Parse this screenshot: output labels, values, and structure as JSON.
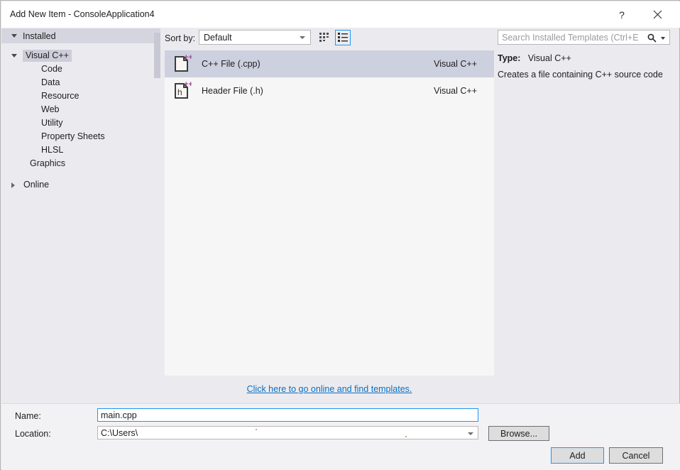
{
  "window": {
    "title": "Add New Item - ConsoleApplication4",
    "help_label": "?",
    "close_label": "✕",
    "help_icon": "question-mark-icon",
    "close_icon": "close-icon"
  },
  "sidebar": {
    "installed": {
      "label": "Installed",
      "expanded": true
    },
    "tree": [
      {
        "label": "Visual C++",
        "level": 1,
        "selected": true,
        "expanded": true
      },
      {
        "label": "Code",
        "level": 2,
        "selected": false
      },
      {
        "label": "Data",
        "level": 2,
        "selected": false
      },
      {
        "label": "Resource",
        "level": 2,
        "selected": false
      },
      {
        "label": "Web",
        "level": 2,
        "selected": false
      },
      {
        "label": "Utility",
        "level": 2,
        "selected": false
      },
      {
        "label": "Property Sheets",
        "level": 2,
        "selected": false
      },
      {
        "label": "HLSL",
        "level": 2,
        "selected": false
      },
      {
        "label": "Graphics",
        "level": 3,
        "selected": false
      }
    ],
    "online": {
      "label": "Online",
      "expanded": false
    }
  },
  "toolbar": {
    "sort_label": "Sort by:",
    "sort_value": "Default",
    "sort_options": [
      "Default"
    ],
    "tile_view_icon": "grid-view-icon",
    "list_view_icon": "list-view-icon",
    "active_view": "list"
  },
  "templates": {
    "items": [
      {
        "name": "C++ File (.cpp)",
        "origin": "Visual C++",
        "icon": "cpp-file-icon",
        "selected": true
      },
      {
        "name": "Header File (.h)",
        "origin": "Visual C++",
        "icon": "header-file-icon",
        "selected": false
      }
    ],
    "online_link": "Click here to go online and find templates."
  },
  "search": {
    "placeholder": "Search Installed Templates (Ctrl+E)",
    "value": "",
    "icon": "search-icon",
    "dropdown_icon": "chevron-down-icon"
  },
  "details": {
    "type_key": "Type:",
    "type_value": "Visual C++",
    "description": "Creates a file containing C++ source code"
  },
  "form": {
    "name_label": "Name:",
    "name_value": "main.cpp",
    "location_label": "Location:",
    "location_value": "C:\\Users\\",
    "browse_label": "Browse..."
  },
  "actions": {
    "add_label": "Add",
    "cancel_label": "Cancel"
  },
  "colors": {
    "accent_blue": "#2196f3",
    "link_blue": "#0a6fc2",
    "selection": "#cdd0de",
    "sidebar_band": "#d5d5e0",
    "dialog_bg": "#ebebef",
    "list_bg": "#f6f6f6",
    "icon_purple": "#9b4f96"
  }
}
